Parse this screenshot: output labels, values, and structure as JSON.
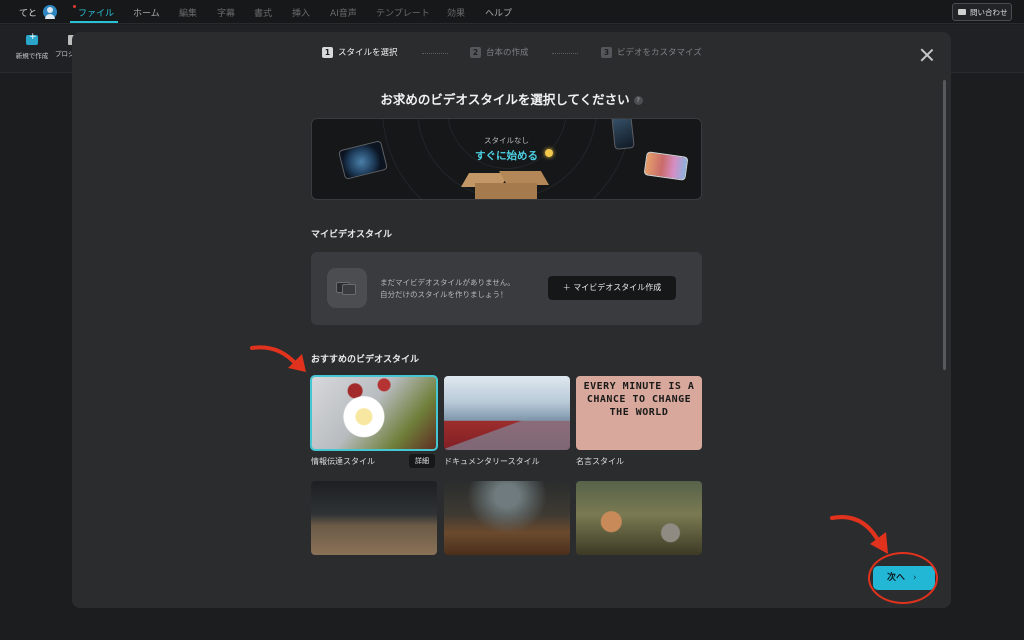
{
  "menubar": {
    "user_name": "てと",
    "items": [
      {
        "label": "ファイル"
      },
      {
        "label": "ホーム"
      },
      {
        "label": "編集"
      },
      {
        "label": "字幕"
      },
      {
        "label": "書式"
      },
      {
        "label": "挿入"
      },
      {
        "label": "AI音声"
      },
      {
        "label": "テンプレート"
      },
      {
        "label": "効果"
      },
      {
        "label": "ヘルプ"
      }
    ],
    "contact_label": "問い合わせ"
  },
  "toolbar": {
    "new_label": "新規で作成",
    "project_label": "プロジェクトを"
  },
  "wizard": {
    "steps": [
      {
        "number": "1",
        "label": "スタイルを選択"
      },
      {
        "number": "2",
        "label": "台本の作成"
      },
      {
        "number": "3",
        "label": "ビデオをカスタマイズ"
      }
    ],
    "title": "お求めのビデオスタイルを選択してください",
    "help_glyph": "?",
    "no_style": {
      "subtitle": "スタイルなし",
      "cta": "すぐに始める"
    },
    "my_styles": {
      "heading": "マイビデオスタイル",
      "empty_line1": "まだマイビデオスタイルがありません。",
      "empty_line2": "自分だけのスタイルを作りましょう！",
      "create_label": "＋ マイビデオスタイル作成"
    },
    "recommended": {
      "heading": "おすすめのビデオスタイル",
      "cards": [
        {
          "caption": "情報伝達スタイル",
          "badge": "詳細",
          "selected": true
        },
        {
          "caption": "ドキュメンタリースタイル"
        },
        {
          "caption": "名言スタイル",
          "image_text": "EVERY MINUTE IS A CHANCE TO CHANGE THE WORLD"
        },
        {
          "caption": ""
        },
        {
          "caption": ""
        },
        {
          "caption": ""
        }
      ]
    },
    "next_label": "次へ",
    "next_chevron": "›"
  },
  "colors": {
    "accent": "#22b7d4",
    "annotation": "#e0321d",
    "modal_bg": "#2b2c2e"
  }
}
